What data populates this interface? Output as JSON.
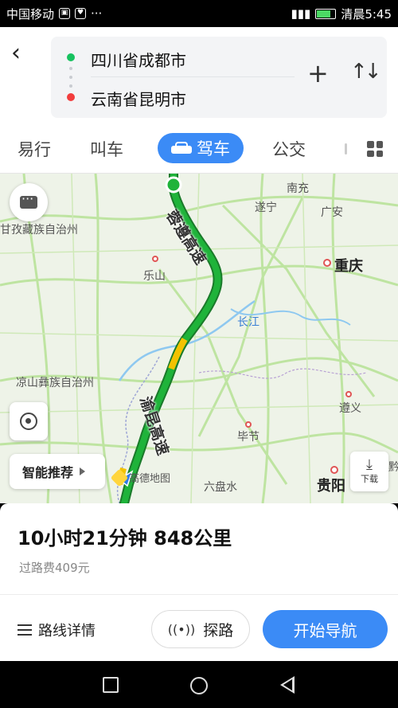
{
  "status_bar": {
    "carrier": "中国移动",
    "time": "清晨5:45"
  },
  "header": {
    "from": "四川省成都市",
    "to": "云南省昆明市"
  },
  "tabs": [
    "易行",
    "叫车",
    "驾车",
    "公交"
  ],
  "active_tab": "驾车",
  "map": {
    "labels": {
      "nanchong": "南充",
      "suining": "遂宁",
      "guangan": "广安",
      "ganzi": "甘孜藏族自治州",
      "leshan": "乐山",
      "chongqing": "重庆",
      "changjiang": "长江",
      "liangshan": "凉山彝族自治州",
      "zunyi": "遵义",
      "bijie": "毕节",
      "liupanshui": "六盘水",
      "guiyang": "贵阳",
      "qian": "黔"
    },
    "highway_top": "蓉遵高速",
    "highway_bottom": "渝昆高速",
    "smart_recommend": "智能推荐",
    "download": "下载",
    "brand": "高德地图",
    "colors": {
      "route": "#1fb33a",
      "route_slow": "#f2c200"
    }
  },
  "summary": {
    "duration_distance": "10小时21分钟  848公里",
    "toll": "过路费409元",
    "details": "路线详情",
    "explore": "探路",
    "start": "开始导航"
  }
}
